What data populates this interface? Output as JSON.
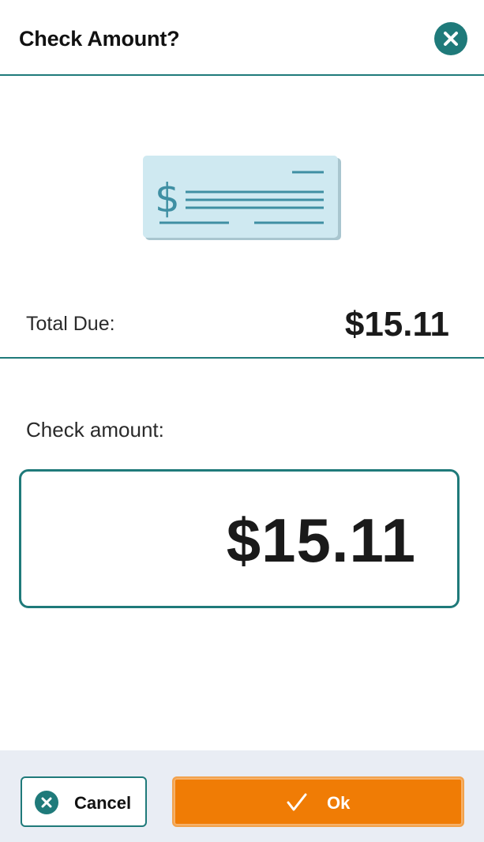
{
  "dialog": {
    "title": "Check Amount?"
  },
  "icons": {
    "close": "close-icon",
    "check": "check-illustration-icon",
    "cancel": "cancel-icon",
    "ok": "checkmark-icon"
  },
  "total": {
    "label": "Total Due:",
    "value": "$15.11"
  },
  "amount": {
    "label": "Check amount:",
    "value": "$15.11"
  },
  "footer": {
    "cancel_label": "Cancel",
    "ok_label": "Ok"
  },
  "colors": {
    "accent": "#1f7a7a",
    "primary_button": "#f07c05",
    "footer_background": "#e9edf4",
    "check_fill": "#cfe9f1"
  }
}
